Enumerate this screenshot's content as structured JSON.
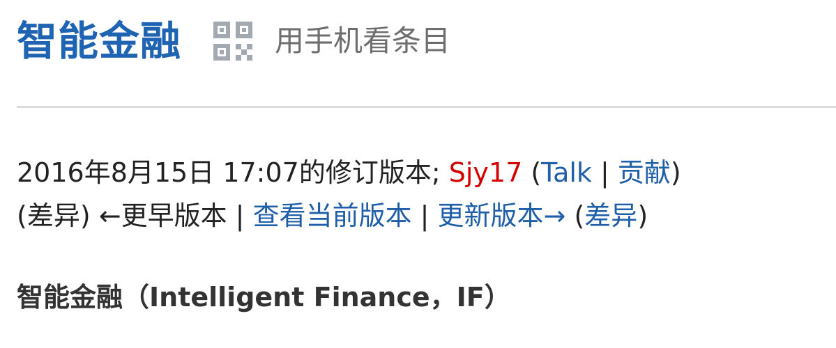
{
  "header": {
    "title": "智能金融",
    "mobile_view_label": "用手机看条目"
  },
  "revision": {
    "prefix": "2016年8月15日 17:07的修订版本; ",
    "user": "Sjy17",
    "open_paren": " (",
    "talk": "Talk",
    "sep": " | ",
    "contrib": "贡献",
    "close_paren": ")",
    "nav": {
      "diff_prev": "差异",
      "older": "←更早版本",
      "current": "查看当前版本",
      "newer": "更新版本→",
      "diff_next": "差异"
    }
  },
  "article": {
    "heading": "智能金融（Intelligent Finance，IF）"
  },
  "colors": {
    "title": "#1f64b2",
    "link": "#1f5ea8",
    "user_link": "#d40000"
  }
}
